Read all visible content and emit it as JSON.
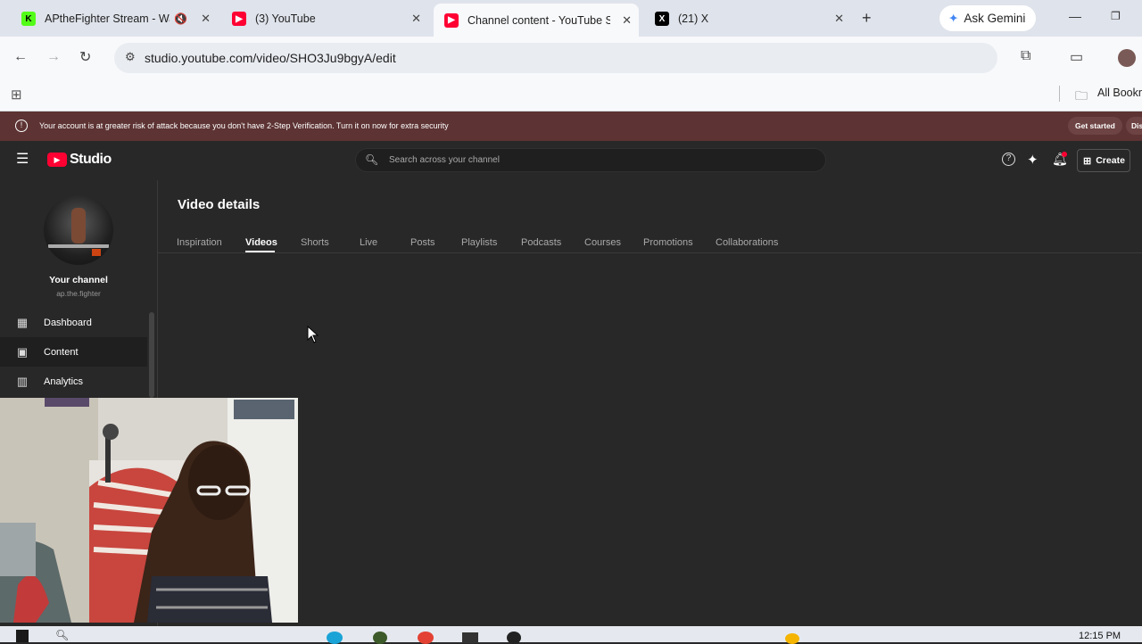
{
  "browser": {
    "tabs": [
      {
        "title": "APtheFighter Stream - Wa",
        "favicon": "K",
        "color": "#53fc18"
      },
      {
        "title": "(3) YouTube",
        "favicon": "yt",
        "color": "#ff0033"
      },
      {
        "title": "Channel content - YouTube St",
        "favicon": "yt",
        "color": "#ff0033",
        "active": true
      },
      {
        "title": "(21) X",
        "favicon": "X",
        "color": "#000000"
      }
    ],
    "gemini_label": "Ask Gemini",
    "url": "studio.youtube.com/video/SHO3Ju9bgyA/edit",
    "bookmarks_label": "All Bookm"
  },
  "banner": {
    "message": "Your account is at greater risk of attack because you don't have 2-Step Verification. Turn it on now for extra security",
    "cta": "Get started",
    "dismiss": "Dis"
  },
  "studio": {
    "logo_text": "Studio",
    "search_placeholder": "Search across your channel",
    "create_label": "Create"
  },
  "channel": {
    "name_label": "Your channel",
    "handle": "ap.the.fighter"
  },
  "sidebar": {
    "items": [
      {
        "label": "Dashboard",
        "icon": "dashboard-icon"
      },
      {
        "label": "Content",
        "icon": "content-icon",
        "active": true
      },
      {
        "label": "Analytics",
        "icon": "analytics-icon"
      }
    ]
  },
  "page": {
    "title": "Video details",
    "tabs": [
      "Inspiration",
      "Videos",
      "Shorts",
      "Live",
      "Posts",
      "Playlists",
      "Podcasts",
      "Courses",
      "Promotions",
      "Collaborations"
    ],
    "active_tab": "Videos"
  },
  "taskbar": {
    "time": "12:15 PM"
  }
}
